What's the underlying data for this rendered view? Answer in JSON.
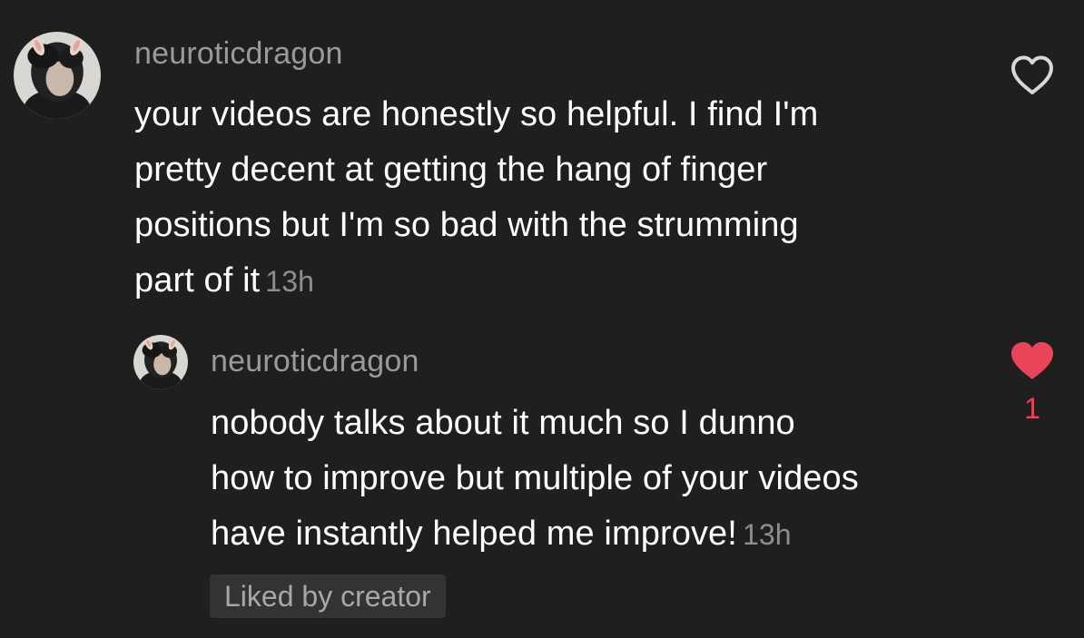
{
  "comment": {
    "username": "neuroticdragon",
    "avatar_icon": "user-avatar",
    "lines": [
      "your videos are honestly so helpful. I find I'm",
      "pretty decent at getting the hang of finger",
      "positions but I'm so bad with the strumming",
      "part of it"
    ],
    "time": "13h",
    "like_icon": "heart-outline-icon",
    "liked": false
  },
  "reply": {
    "username": "neuroticdragon",
    "avatar_icon": "user-avatar",
    "lines": [
      "nobody talks about it much so I dunno",
      "how to improve but multiple of your videos",
      "have instantly helped me improve!"
    ],
    "time": "13h",
    "like_icon": "heart-filled-icon",
    "liked": true,
    "like_count": "1",
    "badge": "Liked by creator"
  },
  "colors": {
    "background": "#1f1f1f",
    "username": "#9a9a9a",
    "text": "#ffffff",
    "timestamp": "#8e8e8e",
    "heart_outline": "#d8d8d8",
    "heart_filled": "#e9445a",
    "badge_bg": "#333333",
    "badge_text": "#a8a8a8"
  }
}
